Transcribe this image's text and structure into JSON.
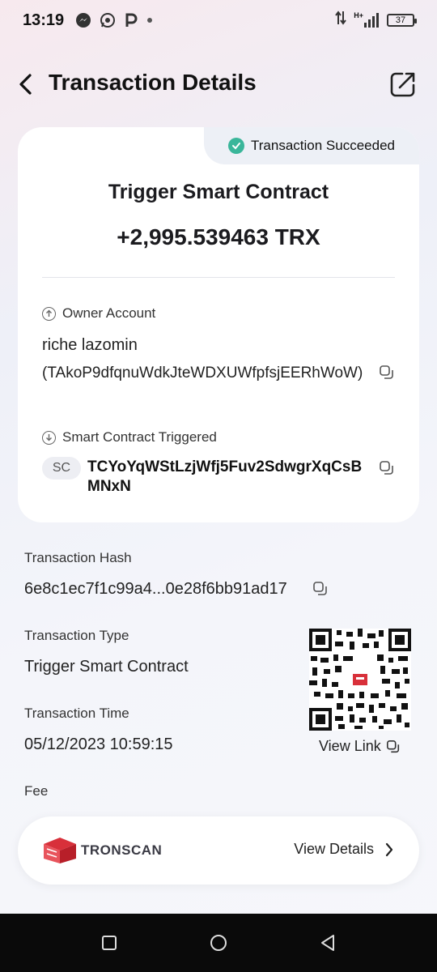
{
  "status_bar": {
    "time": "13:19",
    "network": "H+",
    "battery": "37"
  },
  "header": {
    "title": "Transaction Details"
  },
  "card": {
    "status": "Transaction Succeeded",
    "title": "Trigger Smart Contract",
    "amount": "+2,995.539463 TRX",
    "owner_label": "Owner Account",
    "owner_name": "riche lazomin",
    "owner_address": "(TAkoP9dfqnuWdkJteWDXUWfpfsjEERhWoW)",
    "contract_label": "Smart Contract Triggered",
    "contract_badge": "SC",
    "contract_address": "TCYoYqWStLzjWfj5Fuv2SdwgrXqCsBMNxN"
  },
  "details": {
    "hash_label": "Transaction Hash",
    "hash_value": "6e8c1ec7f1c99a4...0e28f6bb91ad17",
    "type_label": "Transaction Type",
    "type_value": "Trigger Smart Contract",
    "time_label": "Transaction Time",
    "time_value": "05/12/2023 10:59:15",
    "fee_label": "Fee",
    "view_link": "View Link"
  },
  "footer": {
    "brand": "TRONSCAN",
    "view_details": "View Details"
  },
  "colors": {
    "success": "#3ab69a",
    "tronscan_red": "#d8303a"
  }
}
